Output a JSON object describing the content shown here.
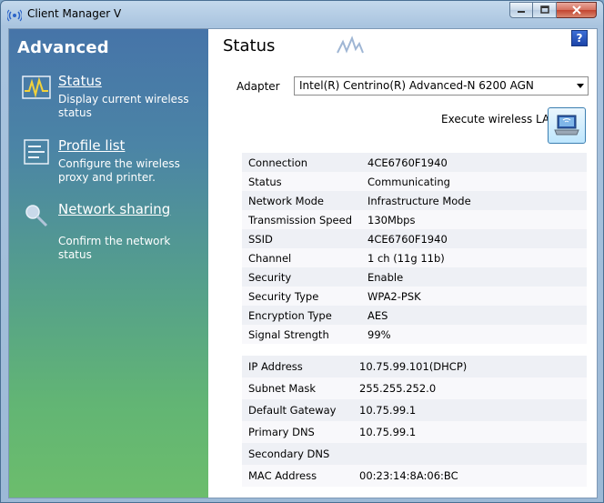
{
  "window": {
    "title": "Client Manager V"
  },
  "sidebar": {
    "title": "Advanced",
    "items": [
      {
        "label": "Status",
        "description": "Display current wireless status",
        "icon": "status-wave-icon"
      },
      {
        "label": "Profile list",
        "description": "Configure the wireless proxy and printer.",
        "icon": "profile-list-icon"
      },
      {
        "label": "Network sharing",
        "description": "Confirm the network status",
        "icon": "magnifier-icon"
      }
    ]
  },
  "main": {
    "title": "Status",
    "help": "?",
    "adapter_label": "Adapter",
    "adapter_value": "Intel(R) Centrino(R) Advanced-N 6200 AGN",
    "execute_label": "Execute wireless LAN",
    "wireless": [
      {
        "label": "Connection",
        "value": "4CE6760F1940"
      },
      {
        "label": "Status",
        "value": "Communicating"
      },
      {
        "label": "Network Mode",
        "value": "Infrastructure Mode"
      },
      {
        "label": "Transmission Speed",
        "value": "130Mbps"
      },
      {
        "label": "SSID",
        "value": "4CE6760F1940"
      },
      {
        "label": "Channel",
        "value": "1 ch (11g 11b)"
      },
      {
        "label": "Security",
        "value": "Enable"
      },
      {
        "label": "Security Type",
        "value": "WPA2-PSK"
      },
      {
        "label": "Encryption Type",
        "value": "AES"
      },
      {
        "label": "Signal Strength",
        "value": "99%"
      }
    ],
    "network": [
      {
        "label": "IP Address",
        "value": "10.75.99.101(DHCP)"
      },
      {
        "label": "Subnet Mask",
        "value": "255.255.252.0"
      },
      {
        "label": "Default Gateway",
        "value": "10.75.99.1"
      },
      {
        "label": "Primary DNS",
        "value": "10.75.99.1"
      },
      {
        "label": "Secondary DNS",
        "value": ""
      },
      {
        "label": "MAC Address",
        "value": "00:23:14:8A:06:BC"
      }
    ]
  }
}
